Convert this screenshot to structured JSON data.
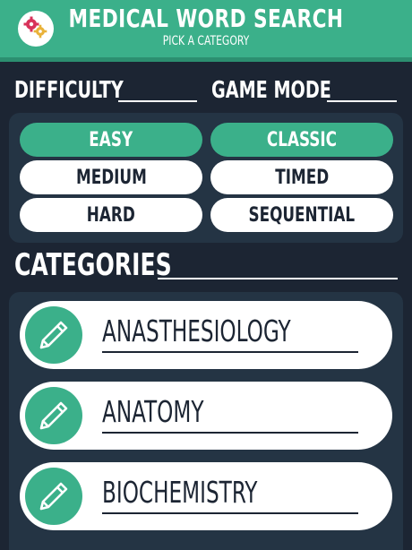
{
  "header": {
    "title": "MEDICAL WORD SEARCH",
    "subtitle": "PICK A CATEGORY",
    "settings_icon": "gears-icon"
  },
  "difficulty": {
    "label": "DIFFICULTY",
    "options": [
      "EASY",
      "MEDIUM",
      "HARD"
    ],
    "selected": "EASY"
  },
  "game_mode": {
    "label": "GAME MODE",
    "options": [
      "CLASSIC",
      "TIMED",
      "SEQUENTIAL"
    ],
    "selected": "CLASSIC"
  },
  "categories": {
    "label": "CATEGORIES",
    "items": [
      {
        "label": "ANASTHESIOLOGY",
        "icon": "pencil-icon"
      },
      {
        "label": "ANATOMY",
        "icon": "pencil-icon"
      },
      {
        "label": "BIOCHEMISTRY",
        "icon": "pencil-icon"
      }
    ]
  },
  "colors": {
    "accent": "#3bb08a",
    "background": "#1c2533",
    "panel": "#243444",
    "button": "#ffffff"
  }
}
